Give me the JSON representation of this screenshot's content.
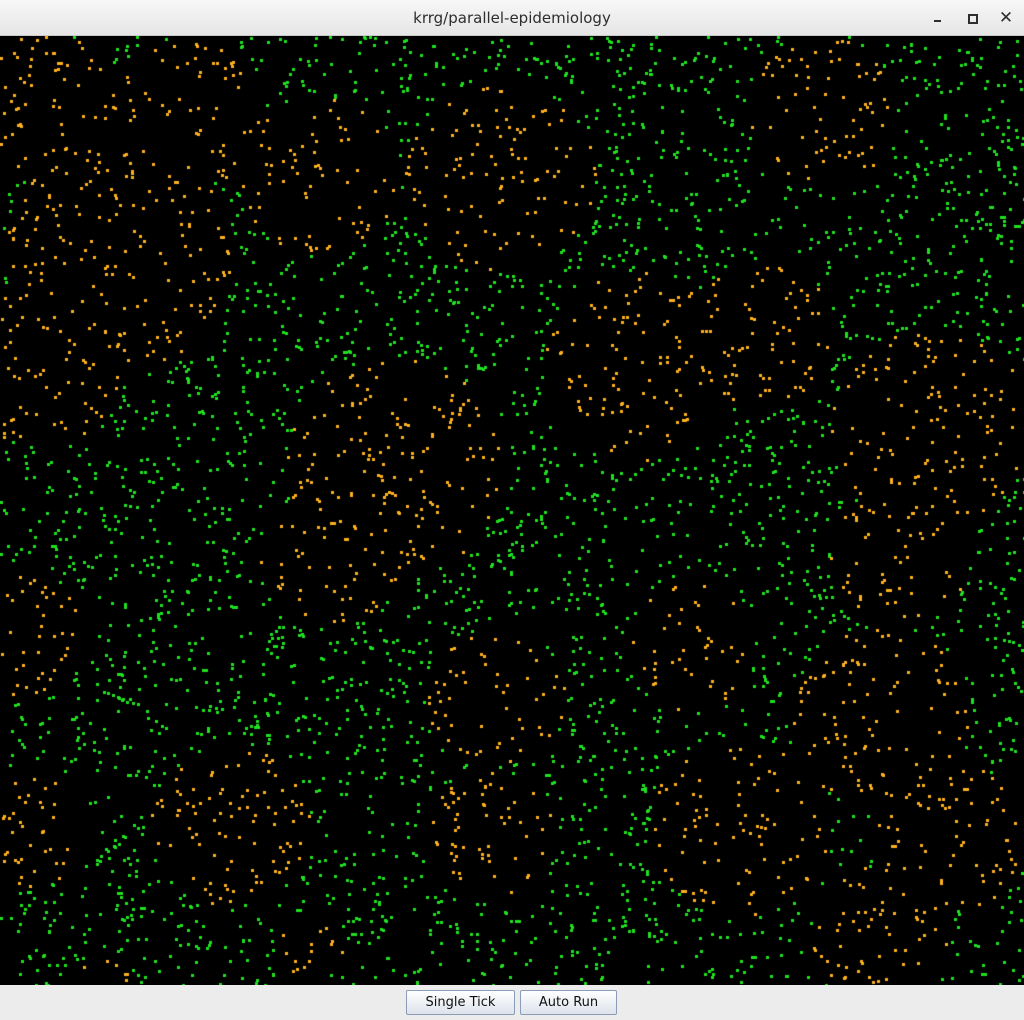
{
  "window": {
    "title": "krrg/parallel-epidemiology",
    "controls": {
      "minimize_icon": "minimize-icon",
      "maximize_icon": "maximize-icon",
      "close_icon": "close-icon",
      "close_glyph": "✕"
    }
  },
  "simulation": {
    "background_color": "#000000",
    "healthy_color": "#1fe11f",
    "infected_color": "#fdb11e",
    "infected_clusters_visible": 25
  },
  "toolbar": {
    "single_tick_label": "Single Tick",
    "auto_run_label": "Auto Run"
  }
}
